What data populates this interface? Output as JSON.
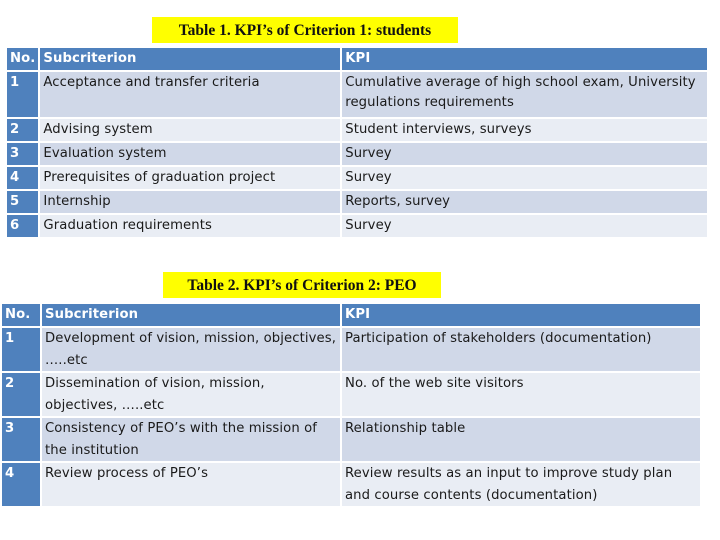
{
  "tables": [
    {
      "caption": "Table 1. KPI’s of Criterion 1: students",
      "headers": {
        "no": "No.",
        "subcriterion": "Subcriterion",
        "kpi": "KPI"
      },
      "rows": [
        {
          "no": "1",
          "subcriterion": "Acceptance and transfer criteria",
          "kpi": "Cumulative average of high school exam, University regulations requirements"
        },
        {
          "no": "2",
          "subcriterion": "Advising system",
          "kpi": "Student interviews, surveys"
        },
        {
          "no": "3",
          "subcriterion": "Evaluation system",
          "kpi": "Survey"
        },
        {
          "no": "4",
          "subcriterion": "Prerequisites of graduation project",
          "kpi": "Survey"
        },
        {
          "no": "5",
          "subcriterion": "Internship",
          "kpi": "Reports, survey"
        },
        {
          "no": "6",
          "subcriterion": "Graduation requirements",
          "kpi": "Survey"
        }
      ]
    },
    {
      "caption": "Table 2. KPI’s of Criterion 2: PEO",
      "headers": {
        "no": "No.",
        "subcriterion": "Subcriterion",
        "kpi": "KPI"
      },
      "rows": [
        {
          "no": "1",
          "subcriterion": "Development of vision, mission, objectives, …..etc",
          "kpi": "Participation of stakeholders (documentation)"
        },
        {
          "no": "2",
          "subcriterion": "Dissemination of vision, mission, objectives, …..etc",
          "kpi": "No. of the web site visitors"
        },
        {
          "no": "3",
          "subcriterion": "Consistency of PEO’s with the mission of the institution",
          "kpi": "Relationship table"
        },
        {
          "no": "4",
          "subcriterion": "Review process of PEO’s",
          "kpi": "Review results as an input to improve study plan and course contents (documentation)"
        }
      ]
    }
  ],
  "colors": {
    "caption_highlight": "#ffff00",
    "header_fill": "#4f81bd",
    "row_dark": "#d0d8e8",
    "row_light": "#e9edf4"
  }
}
